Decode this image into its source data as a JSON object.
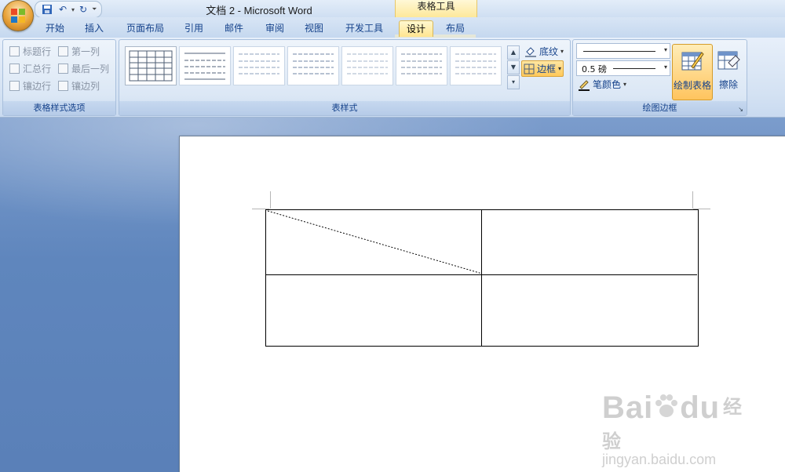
{
  "window": {
    "title": "文档 2 - Microsoft Word",
    "context_tab_group": "表格工具"
  },
  "tabs": [
    {
      "label": "开始"
    },
    {
      "label": "插入"
    },
    {
      "label": "页面布局"
    },
    {
      "label": "引用"
    },
    {
      "label": "邮件"
    },
    {
      "label": "审阅"
    },
    {
      "label": "视图"
    },
    {
      "label": "开发工具"
    },
    {
      "label": "设计",
      "active": true
    },
    {
      "label": "布局"
    }
  ],
  "ribbon": {
    "table_style_options": {
      "label": "表格样式选项",
      "options": [
        {
          "label": "标题行",
          "checked": false
        },
        {
          "label": "第一列",
          "checked": false
        },
        {
          "label": "汇总行",
          "checked": false
        },
        {
          "label": "最后一列",
          "checked": false
        },
        {
          "label": "镶边行",
          "checked": false
        },
        {
          "label": "镶边列",
          "checked": false
        }
      ]
    },
    "table_styles": {
      "label": "表样式",
      "shading_label": "底纹",
      "borders_label": "边框"
    },
    "draw_borders": {
      "label": "绘图边框",
      "line_weight": "0.5 磅",
      "pen_color_label": "笔颜色",
      "draw_table_label": "绘制表格",
      "eraser_label": "擦除"
    }
  },
  "colors": {
    "accent_active": "#ffc95a",
    "ribbon_text": "#15428b",
    "workspace": "#5f86bd"
  },
  "watermark": {
    "brand": "Bai",
    "brand2": "du",
    "cn": "经验",
    "url": "jingyan.baidu.com"
  }
}
